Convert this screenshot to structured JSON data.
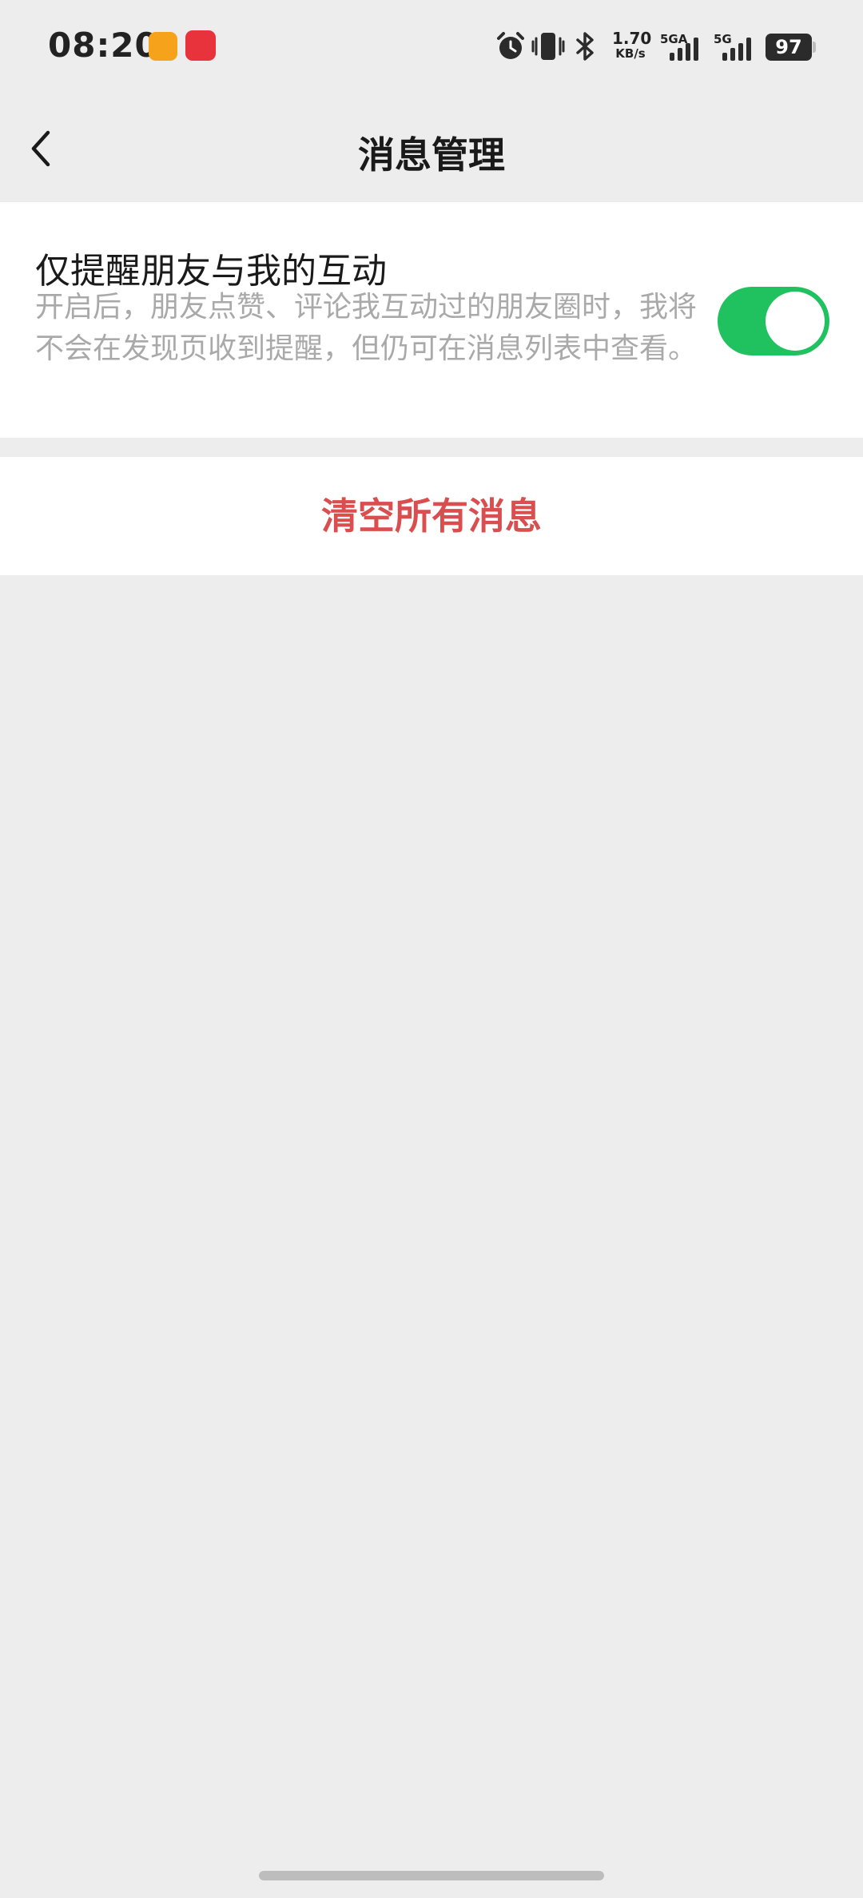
{
  "status_bar": {
    "time": "08:20",
    "net_speed_value": "1.70",
    "net_speed_unit": "KB/s",
    "network1_label": "5GA",
    "network2_label": "5G",
    "battery": "97",
    "icons": [
      "app-notification-orange-icon",
      "app-notification-red-icon",
      "alarm-icon",
      "vibrate-icon",
      "bluetooth-icon",
      "signal-icon",
      "signal-icon"
    ]
  },
  "nav": {
    "title": "消息管理",
    "back_icon": "chevron-left-icon"
  },
  "setting": {
    "title": "仅提醒朋友与我的互动",
    "description": "开启后，朋友点赞、评论我互动过的朋友圈时，我将不会在发现页收到提醒，但仍可在消息列表中查看。",
    "toggle_on": true
  },
  "actions": {
    "clear_all": "清空所有消息"
  },
  "colors": {
    "background": "#ededed",
    "card": "#ffffff",
    "toggle_on": "#20c15f",
    "danger_text": "#d94f4f",
    "secondary_text": "#a9a9a9"
  }
}
